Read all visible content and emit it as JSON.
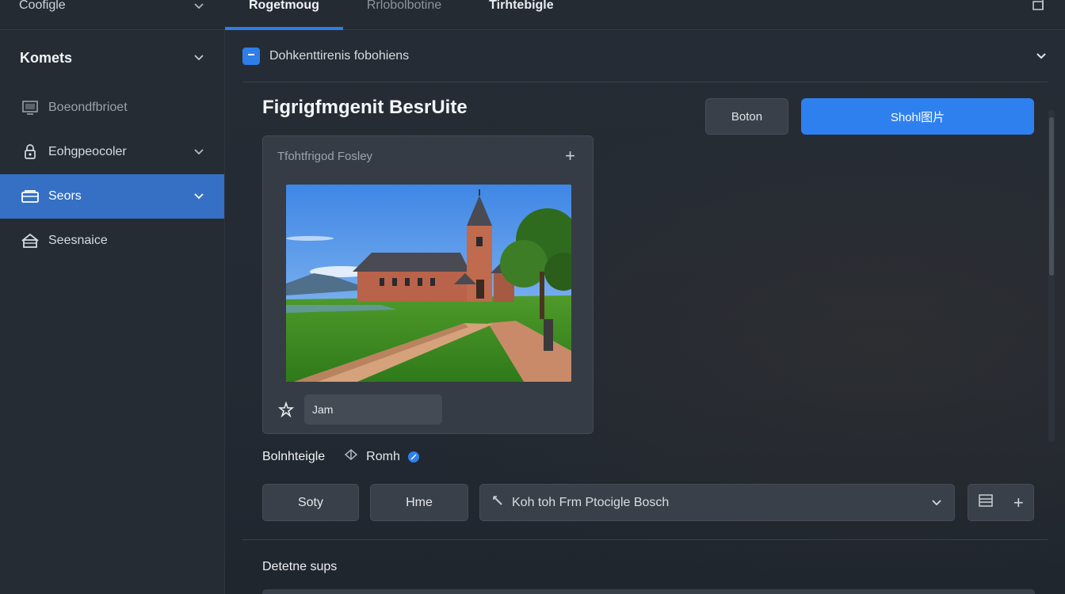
{
  "topbar": {
    "app_title": "Coofigle",
    "tabs": [
      {
        "label": "Rogetmoug",
        "active": true
      },
      {
        "label": "Rrlobolbotine",
        "active": false
      },
      {
        "label": "Tirhtebigle",
        "active": false
      }
    ]
  },
  "sidebar": {
    "header": "Komets",
    "items": [
      {
        "label": "Boeondfbrioet",
        "icon": "monitor-icon",
        "has_chevron": false,
        "active": false,
        "muted": true
      },
      {
        "label": "Eohgpeocoler",
        "icon": "lock-icon",
        "has_chevron": true,
        "active": false,
        "muted": false
      },
      {
        "label": "Seors",
        "icon": "folder-icon",
        "has_chevron": true,
        "active": true,
        "muted": false
      },
      {
        "label": "Seesnaice",
        "icon": "home-icon",
        "has_chevron": false,
        "active": false,
        "muted": false
      }
    ]
  },
  "main": {
    "breadcrumb": "Dohkenttirenis fobohiens",
    "title": "Figrigfmgenit BesrUite",
    "actions": {
      "secondary": "Boton",
      "primary": "Shohl图片"
    },
    "card": {
      "title": "Tfohtfrigod Fosley",
      "tag_value": "Jam"
    },
    "field_row": {
      "label": "Bolnhteigle",
      "option": "Romh"
    },
    "controls": {
      "chip1": "Soty",
      "chip2": "Hme",
      "select_value": "Koh toh Frm Ptocigle Bosch"
    },
    "section_label": "Detetne sups"
  },
  "colors": {
    "accent": "#2f80ef",
    "sidebar_active": "#3570c4",
    "panel": "#363c45",
    "background": "#1f252d"
  }
}
